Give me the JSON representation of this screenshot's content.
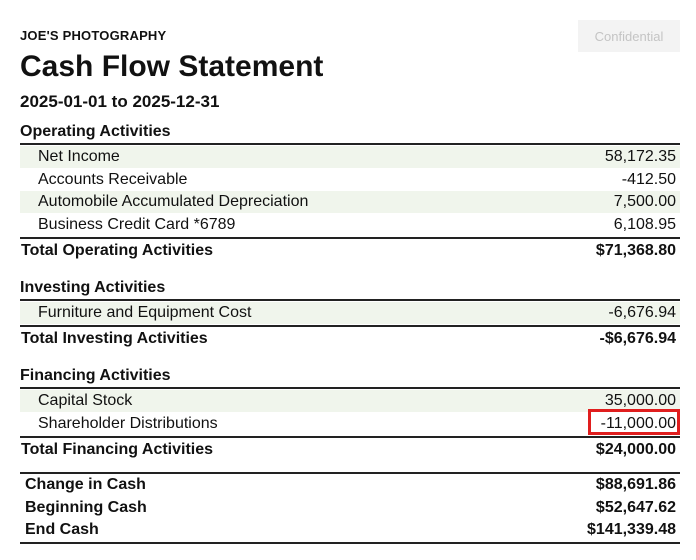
{
  "header": {
    "company": "JOE'S PHOTOGRAPHY",
    "title": "Cash Flow Statement",
    "date_range": "2025-01-01 to 2025-12-31",
    "confidential_label": "Confidential"
  },
  "operating": {
    "heading": "Operating Activities",
    "items": [
      {
        "label": "Net Income",
        "value": "58,172.35"
      },
      {
        "label": "Accounts Receivable",
        "value": "-412.50"
      },
      {
        "label": "Automobile Accumulated Depreciation",
        "value": "7,500.00"
      },
      {
        "label": "Business Credit Card *6789",
        "value": "6,108.95"
      }
    ],
    "total_label": "Total Operating Activities",
    "total_value": "$71,368.80"
  },
  "investing": {
    "heading": "Investing Activities",
    "items": [
      {
        "label": "Furniture and Equipment Cost",
        "value": "-6,676.94"
      }
    ],
    "total_label": "Total Investing Activities",
    "total_value": "-$6,676.94"
  },
  "financing": {
    "heading": "Financing Activities",
    "items": [
      {
        "label": "Capital Stock",
        "value": "35,000.00"
      },
      {
        "label": "Shareholder Distributions",
        "value": "-11,000.00"
      }
    ],
    "total_label": "Total Financing Activities",
    "total_value": "$24,000.00"
  },
  "summary": [
    {
      "label": "Change in Cash",
      "value": "$88,691.86"
    },
    {
      "label": "Beginning Cash",
      "value": "$52,647.62"
    },
    {
      "label": "End Cash",
      "value": "$141,339.48"
    }
  ],
  "colors": {
    "row_shade": "#f0f5ec",
    "highlight": "#e01e1e",
    "button_text": "#c4c4c4"
  }
}
